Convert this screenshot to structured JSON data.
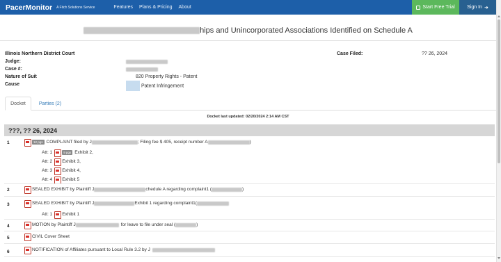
{
  "nav": {
    "brand": "PacerMonitor",
    "tagline": "A Fitch Solutions Service",
    "links": [
      "Features",
      "Plans & Pricing",
      "About"
    ],
    "trial_label": "Start Free Trial",
    "signin_label": "Sign In"
  },
  "case": {
    "title_visible": "hips and Unincorporated Associations Identified on Schedule A",
    "court": "Illinois Northern District Court",
    "labels": {
      "judge": "Judge:",
      "case_no": "Case #:",
      "nature": "Nature of Suit",
      "cause": "Cause",
      "filed": "Case Filed:"
    },
    "nature_value": "820 Property Rights - Patent",
    "cause_value": "Patent Infringement",
    "filed_value": "?? 26, 2024"
  },
  "tabs": {
    "docket": "Docket",
    "parties": "Parties (2)"
  },
  "docket": {
    "updated": "Docket last updated: 02/20/2024 2:14 AM CST",
    "date_header": "???, ?? 26, 2024",
    "entries": [
      {
        "num": "1",
        "badge": "12 pgs",
        "text_a": "COMPLAINT filed by J",
        "text_b": "; Filing fee $ 405, receipt number A",
        "attachments": [
          {
            "label": "Att: 1",
            "badge": "9 pgs",
            "text": "Exhibit 2,"
          },
          {
            "label": "Att: 2",
            "text": "Exhibit 3,"
          },
          {
            "label": "Att: 3",
            "text": "Exhibit 4,"
          },
          {
            "label": "Att: 4",
            "text": "Exhibit 5"
          }
        ]
      },
      {
        "num": "2",
        "text_a": "SEALED EXHIBIT by Plaintiff J",
        "text_b": "chedule A regarding complaint1 ("
      },
      {
        "num": "3",
        "text_a": "SEALED EXHIBIT by Plaintiff J",
        "text_b": "Exhibit 1 regarding complaint1(",
        "attachments": [
          {
            "label": "Att: 1",
            "text": "Exhibit 1"
          }
        ]
      },
      {
        "num": "4",
        "text_a": "MOTION by Plaintiff J",
        "text_b": "for leave to file under seal ("
      },
      {
        "num": "5",
        "text_a": "CIVIL Cover Sheet"
      },
      {
        "num": "6",
        "text_a": "NOTIFICATION of Affiliates pursuant to Local Rule 3.2 by J"
      }
    ]
  },
  "colors": {
    "navbar": "#1d5fa9",
    "trial": "#5cb85c",
    "signin": "#286090",
    "date_bar": "#d6d6d6"
  }
}
